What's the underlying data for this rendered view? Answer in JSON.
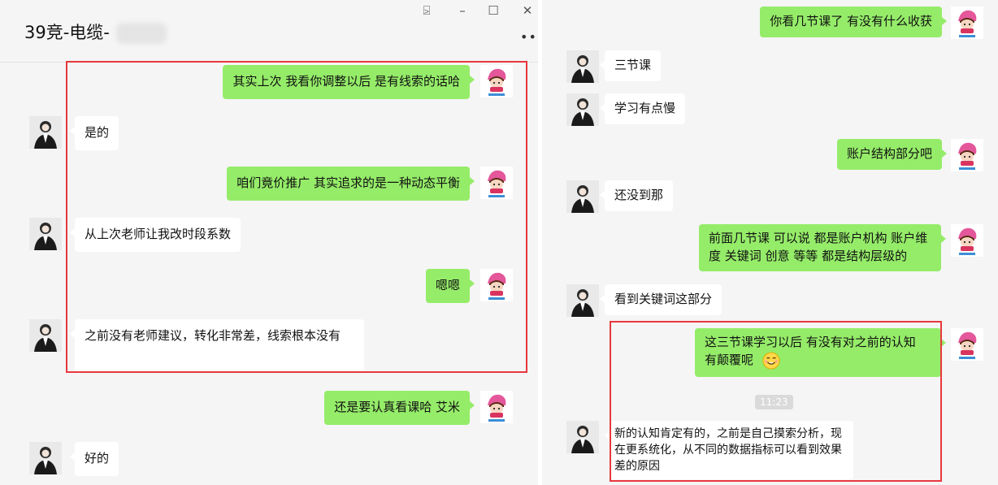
{
  "left_window": {
    "title": "39竞-电缆-",
    "controls": {
      "pin": "⍄",
      "minimize": "–",
      "maximize": "☐",
      "close": "✕",
      "more": "•••"
    },
    "messages": [
      {
        "side": "out",
        "text": "其实上次 我看你调整以后 是有线索的话哈"
      },
      {
        "side": "in",
        "text": "是的"
      },
      {
        "side": "out",
        "text": "咱们竟价推广  其实追求的是一种动态平衡"
      },
      {
        "side": "in",
        "text": "从上次老师让我改时段系数"
      },
      {
        "side": "out",
        "text": "嗯嗯"
      },
      {
        "side": "in",
        "text": "之前没有老师建议，转化非常差，线索根本没有"
      },
      {
        "side": "out",
        "text": "还是要认真看课哈   艾米"
      },
      {
        "side": "in",
        "text": "好的"
      }
    ]
  },
  "right_window": {
    "messages": [
      {
        "side": "out",
        "text": "你看几节课了  有没有什么收获"
      },
      {
        "side": "in",
        "text": "三节课"
      },
      {
        "side": "in",
        "text": "学习有点慢"
      },
      {
        "side": "out",
        "text": "账户结构部分吧"
      },
      {
        "side": "in",
        "text": "还没到那"
      },
      {
        "side": "out",
        "text": "前面几节课 可以说 都是账户机构   账户维度  关键词  创意 等等 都是结构层级的"
      },
      {
        "side": "in",
        "text": "看到关键词这部分"
      },
      {
        "side": "out",
        "text": "这三节课学习以后  有没有对之前的认知 有颠覆呢",
        "emoji": "smile-emoji"
      },
      {
        "side": "in",
        "text": "新的认知肯定有的，之前是自己摸索分析，现在更系统化，从不同的数据指标可以看到效果差的原因"
      }
    ],
    "timestamp": "11:23"
  },
  "colors": {
    "outgoing_bubble": "#95ec69",
    "incoming_bubble": "#ffffff",
    "highlight_box": "#e8383d",
    "chat_background": "#f5f5f5"
  },
  "icons": {
    "agent_avatar": "cartoon-girl-avatar",
    "user_avatar": "person-photo-avatar"
  }
}
